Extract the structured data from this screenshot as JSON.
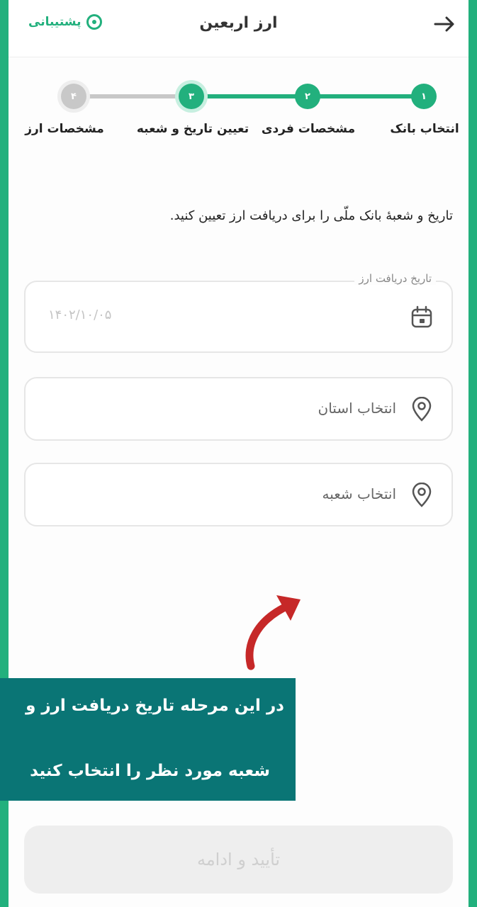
{
  "header": {
    "title": "ارز اربعین",
    "support_label": "پشتیبانی",
    "back_icon": "arrow-right-icon",
    "support_icon": "headset-icon"
  },
  "stepper": {
    "steps": [
      {
        "number": "۱",
        "label": "انتخاب بانک",
        "state": "done"
      },
      {
        "number": "۲",
        "label": "مشخصات فردی",
        "state": "done"
      },
      {
        "number": "۳",
        "label": "تعیین تاریخ و شعبه",
        "state": "active"
      },
      {
        "number": "۴",
        "label": "مشخصات ارز",
        "state": "pending"
      }
    ]
  },
  "instruction": "تاریخ و شعبهٔ بانک ملّی را برای دریافت ارز تعیین کنید.",
  "form": {
    "date_field": {
      "label": "تاریخ دریافت ارز",
      "value": "۱۴۰۲/۱۰/۰۵",
      "icon": "calendar-icon"
    },
    "province_field": {
      "placeholder": "انتخاب استان",
      "icon": "location-pin-icon"
    },
    "branch_field": {
      "placeholder": "انتخاب شعبه",
      "icon": "location-pin-icon"
    }
  },
  "annotation": {
    "caption_line1": "در این مرحله تاریخ دریافت ارز و",
    "caption_line2": "شعبه مورد نظر را انتخاب کنید",
    "arrow_icon": "curved-arrow-icon"
  },
  "confirm_button": {
    "label": "تأیید و ادامه",
    "enabled": false
  },
  "colors": {
    "accent": "#22b07d",
    "pending": "#c8c8c8",
    "caption_bg": "#0a7575",
    "arrow": "#c62828"
  }
}
